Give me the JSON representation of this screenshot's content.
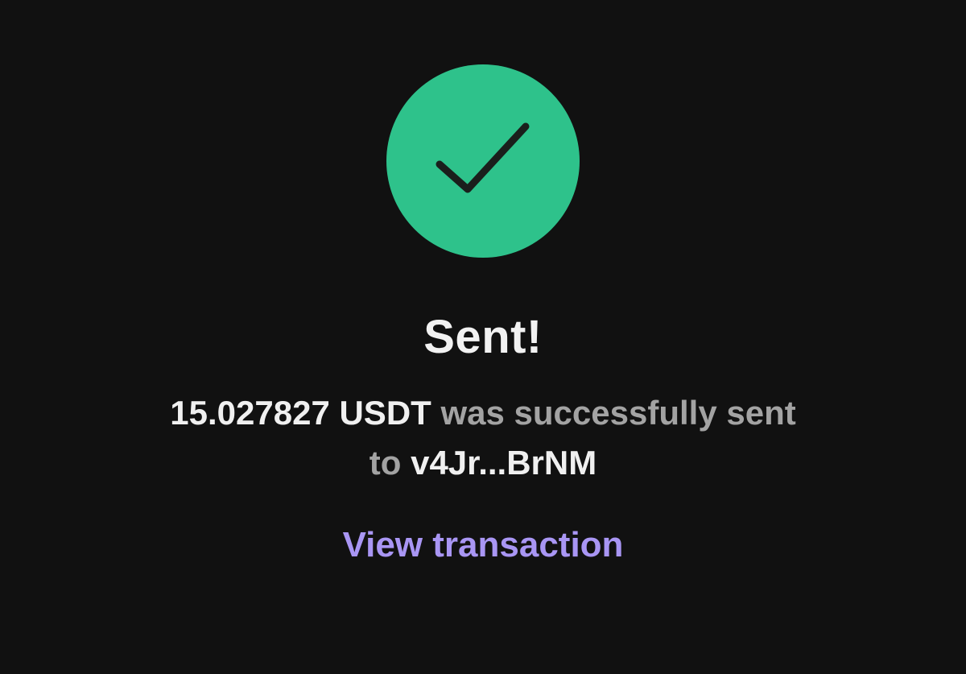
{
  "status_icon": {
    "name": "checkmark-icon",
    "circle_color": "#2ec28b",
    "check_color": "#1a1f1c"
  },
  "title": "Sent!",
  "message": {
    "amount": "15.027827 USDT",
    "middle": " was successfully sent",
    "prefix_to": "to ",
    "recipient": "v4Jr...BrNM"
  },
  "actions": {
    "view_transaction": "View transaction"
  },
  "colors": {
    "background": "#111111",
    "link": "#a996f4"
  }
}
